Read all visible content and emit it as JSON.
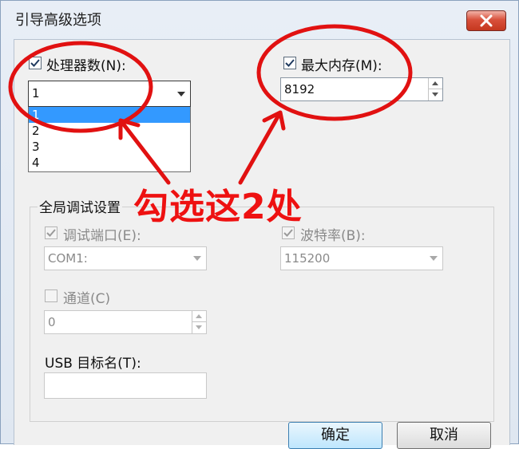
{
  "window": {
    "title": "引导高级选项"
  },
  "processors": {
    "label": "处理器数(N):",
    "checked": true,
    "value": "1",
    "options": [
      "1",
      "2",
      "3",
      "4"
    ]
  },
  "max_memory": {
    "label": "最大内存(M):",
    "checked": true,
    "value": "8192"
  },
  "global_debug": {
    "group_label": "全局调试设置",
    "debug_port": {
      "label": "调试端口(E):",
      "checked": true,
      "value": "COM1:"
    },
    "baud_rate": {
      "label": "波特率(B):",
      "checked": true,
      "value": "115200"
    },
    "channel": {
      "label": "通道(C)",
      "checked": false,
      "value": "0"
    },
    "usb_target": {
      "label": "USB 目标名(T):",
      "value": ""
    }
  },
  "buttons": {
    "ok": "确定",
    "cancel": "取消"
  },
  "annotation": {
    "text": "勾选这2处",
    "color": "#e11111"
  }
}
